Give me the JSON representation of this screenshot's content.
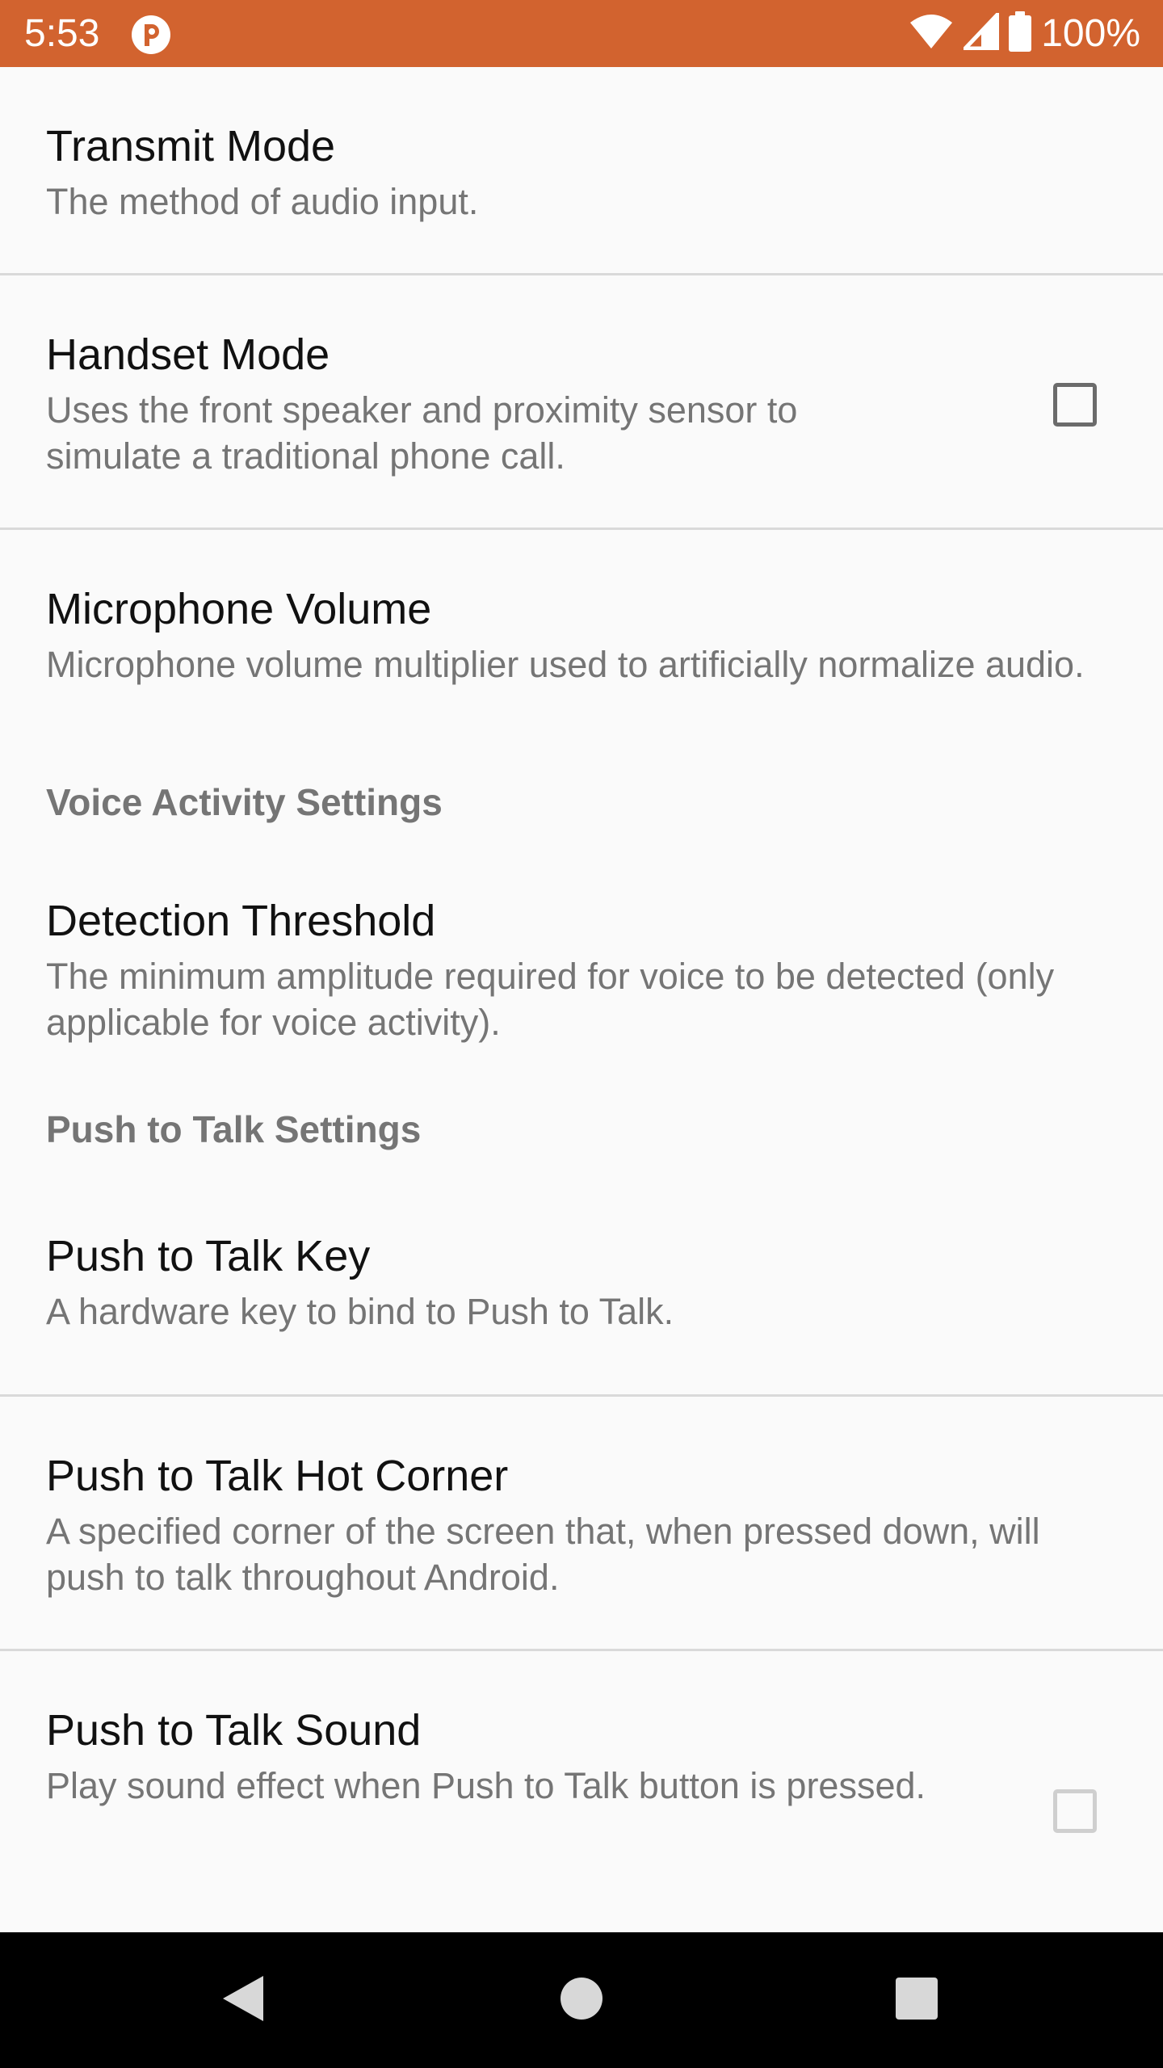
{
  "status_bar": {
    "time": "5:53",
    "battery": "100%",
    "color": "#d2632f",
    "icons": [
      "app-notification-icon",
      "wifi-icon",
      "cell-signal-icon",
      "battery-icon"
    ]
  },
  "preferences": {
    "transmit_mode": {
      "title": "Transmit Mode",
      "summary": "The method of audio input."
    },
    "handset_mode": {
      "title": "Handset Mode",
      "summary": "Uses the front speaker and proximity sensor to simulate a traditional phone call.",
      "checked": false
    },
    "microphone_volume": {
      "title": "Microphone Volume",
      "summary": "Microphone volume multiplier used to artificially normalize audio."
    },
    "voice_activity_category": "Voice Activity Settings",
    "detection_threshold": {
      "title": "Detection Threshold",
      "summary": "The minimum amplitude required for voice to be detected (only applicable for voice activity)."
    },
    "push_to_talk_category": "Push to Talk Settings",
    "ptt_key": {
      "title": "Push to Talk Key",
      "summary": "A hardware key to bind to Push to Talk."
    },
    "ptt_hot_corner": {
      "title": "Push to Talk Hot Corner",
      "summary": "A specified corner of the screen that, when pressed down, will push to talk throughout Android."
    },
    "ptt_sound": {
      "title": "Push to Talk Sound",
      "summary": "Play sound effect when Push to Talk button is pressed.",
      "checked": false,
      "enabled": false
    }
  },
  "nav_bar": {
    "icons": [
      "back-icon",
      "home-icon",
      "recents-icon"
    ]
  }
}
